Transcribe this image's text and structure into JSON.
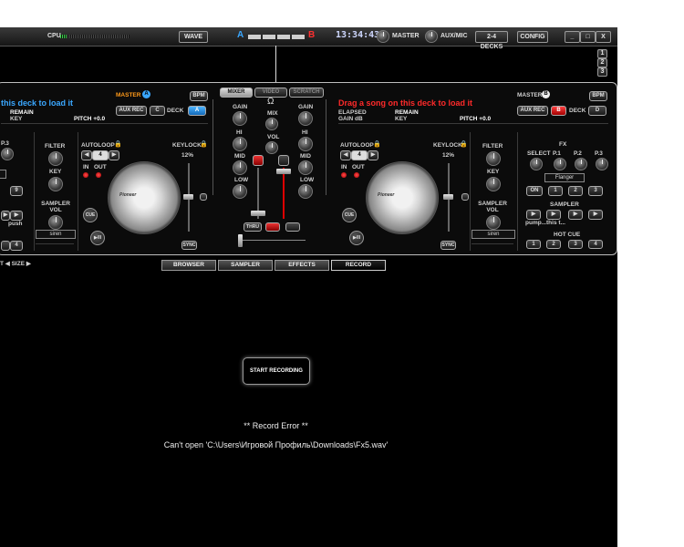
{
  "topbar": {
    "cpu_label": "CPU",
    "cpu_fraction": 0.1,
    "wave_button": "WAVE",
    "deck_a_letter": "A",
    "deck_b_letter": "B",
    "clock": "13:34:43",
    "master_label": "MASTER",
    "auxmic_label": "AUX/MIC",
    "decks_button": "2-4 DECKS",
    "config_button": "CONFIG",
    "minimize": "_",
    "maximize": "□",
    "close": "X"
  },
  "layout_numbers": [
    "1",
    "2",
    "3"
  ],
  "deck_left": {
    "message": "this deck to load it",
    "remain": "REMAIN",
    "key": "KEY",
    "pitch": "PITCH +0.0",
    "master": "MASTER",
    "master_badge": "A",
    "bpm": "BPM",
    "aux_rec": "AUX REC",
    "deck_c": "C",
    "deck_word": "DECK",
    "deck_a": "A",
    "filter": "FILTER",
    "key_knob": "KEY",
    "sampler_vol": "SAMPLER VOL",
    "autoloop": "AUTOLOOP",
    "loop_value": "4",
    "in": "IN",
    "out": "OUT",
    "keylock": "KEYLOCK",
    "pitch_range": "12%",
    "cue": "CUE",
    "play": "▶/II",
    "sync": "SYNC",
    "sampler_name": "siren",
    "p3": "P.3",
    "push": "push",
    "fx_btn_9": "9",
    "fx_btn_4": "4",
    "brand": "Pioneer"
  },
  "mixer": {
    "tabs": [
      "MIXER",
      "VIDEO",
      "SCRATCH"
    ],
    "gain": "GAIN",
    "mix": "MIX",
    "hi": "HI",
    "vol": "VOL",
    "mid": "MID",
    "low": "LOW",
    "thru": "THRU"
  },
  "deck_right": {
    "message": "Drag a song on this deck to load it",
    "elapsed": "ELAPSED",
    "gain_db": "GAIN dB",
    "remain": "REMAIN",
    "key": "KEY",
    "pitch": "PITCH +0.0",
    "master": "MASTER",
    "master_badge": "B",
    "bpm": "BPM",
    "aux_rec": "AUX REC",
    "deck_b": "B",
    "deck_word": "DECK",
    "deck_d": "D",
    "autoloop": "AUTOLOOP",
    "loop_value": "4",
    "in": "IN",
    "out": "OUT",
    "keylock": "KEYLOCK",
    "pitch_range": "12%",
    "cue": "CUE",
    "play": "▶/II",
    "sync": "SYNC",
    "filter": "FILTER",
    "key_knob": "KEY",
    "sampler_vol": "SAMPLER VOL",
    "sampler_name": "siren",
    "fx": "FX",
    "select": "SELECT",
    "p1": "P.1",
    "p2": "P.2",
    "p3": "P.3",
    "fx_name": "Flanger",
    "on": "ON",
    "fx_nums": [
      "1",
      "2",
      "3"
    ],
    "sampler": "SAMPLER",
    "sample_1": "pump...",
    "sample_2": "this t...",
    "hot_cue": "HOT CUE",
    "cue_nums": [
      "1",
      "2",
      "3",
      "4"
    ],
    "brand": "Pioneer"
  },
  "bottom_tabs": [
    "BROWSER",
    "SAMPLER",
    "EFFECTS",
    "RECORD"
  ],
  "size_label": "T ◀ SIZE ▶",
  "record": {
    "button": "START RECORDING",
    "error_title": "** Record Error **",
    "error_message": "Can't open 'C:\\Users\\Игровой Профиль\\Downloads\\Fx5.wav'"
  }
}
